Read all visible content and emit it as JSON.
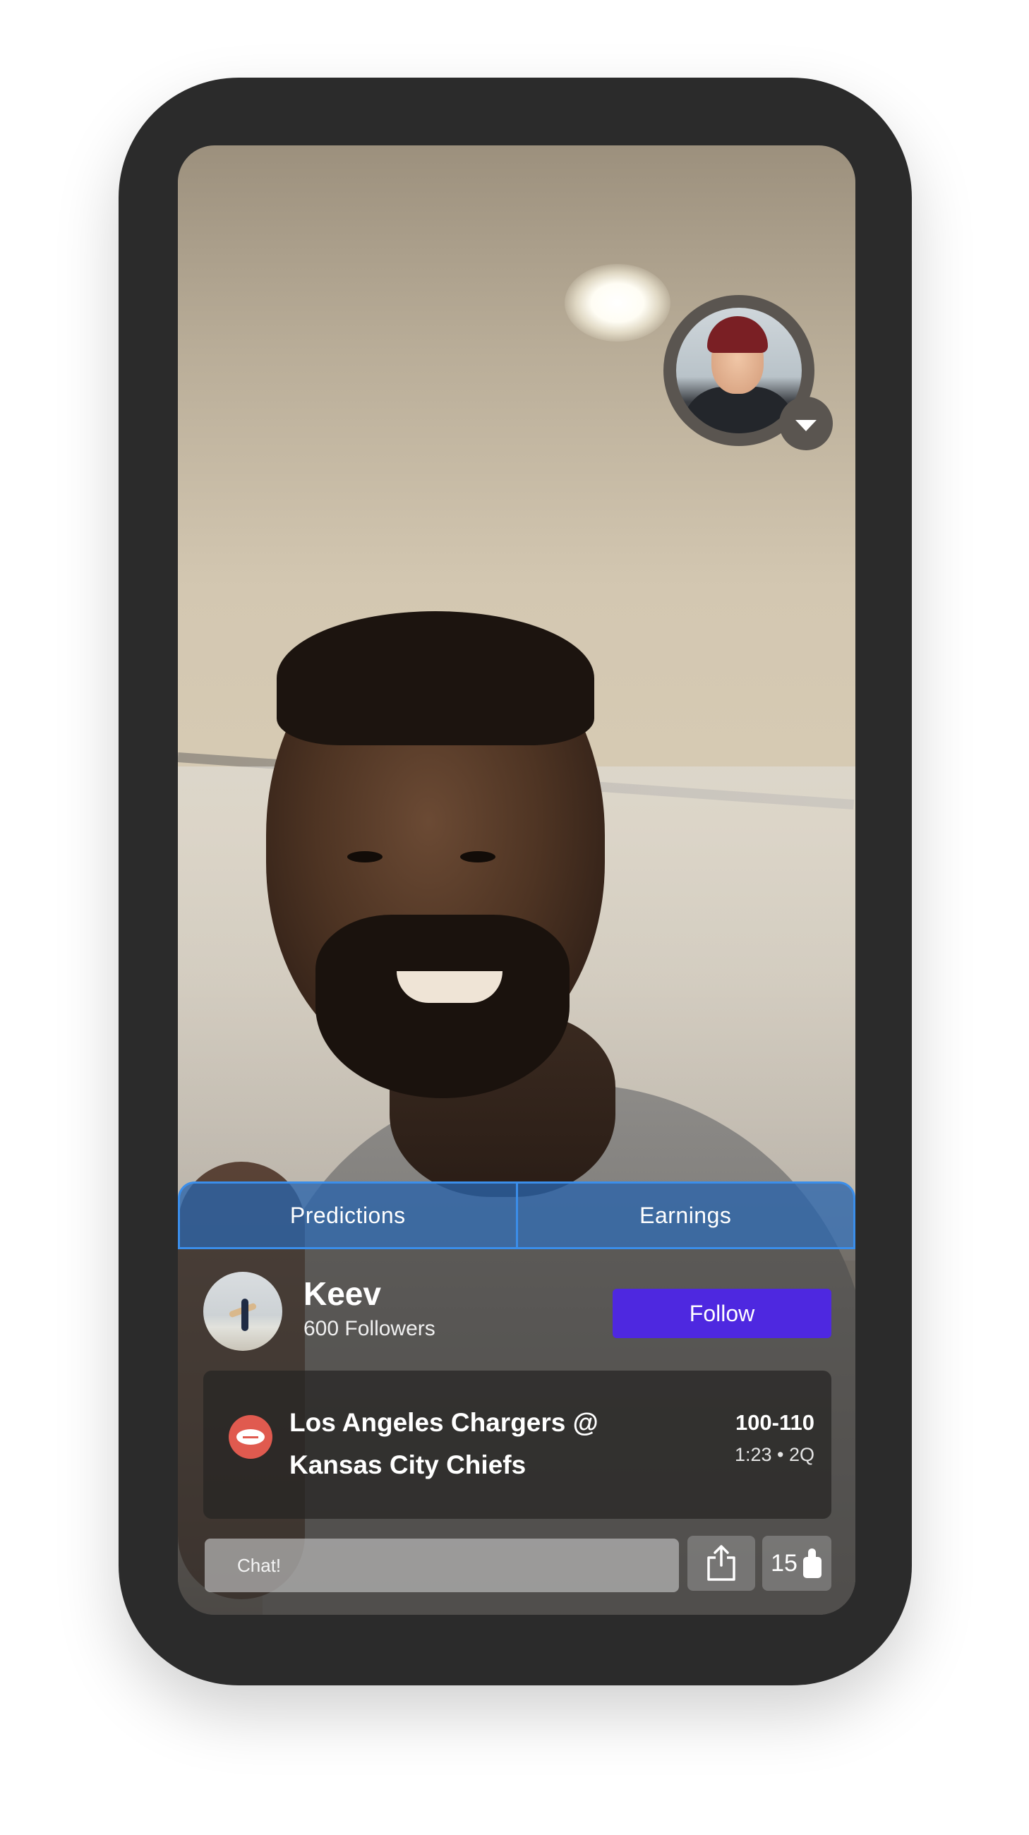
{
  "tabs": [
    {
      "label": "Predictions"
    },
    {
      "label": "Earnings"
    }
  ],
  "streamer": {
    "name": "Keev",
    "followers": "600 Followers",
    "follow_label": "Follow"
  },
  "game": {
    "sport_icon": "football-icon",
    "matchup_line1": "Los Angeles Chargers @",
    "matchup_line2": "Kansas City Chiefs",
    "score": "100-110",
    "clock": "1:23 • 2Q"
  },
  "chat": {
    "placeholder": "Chat!"
  },
  "likes": {
    "count": "15"
  },
  "colors": {
    "accent": "#4e28e0",
    "tab_border": "#3b8eea",
    "sport_badge": "#e05a4f"
  }
}
